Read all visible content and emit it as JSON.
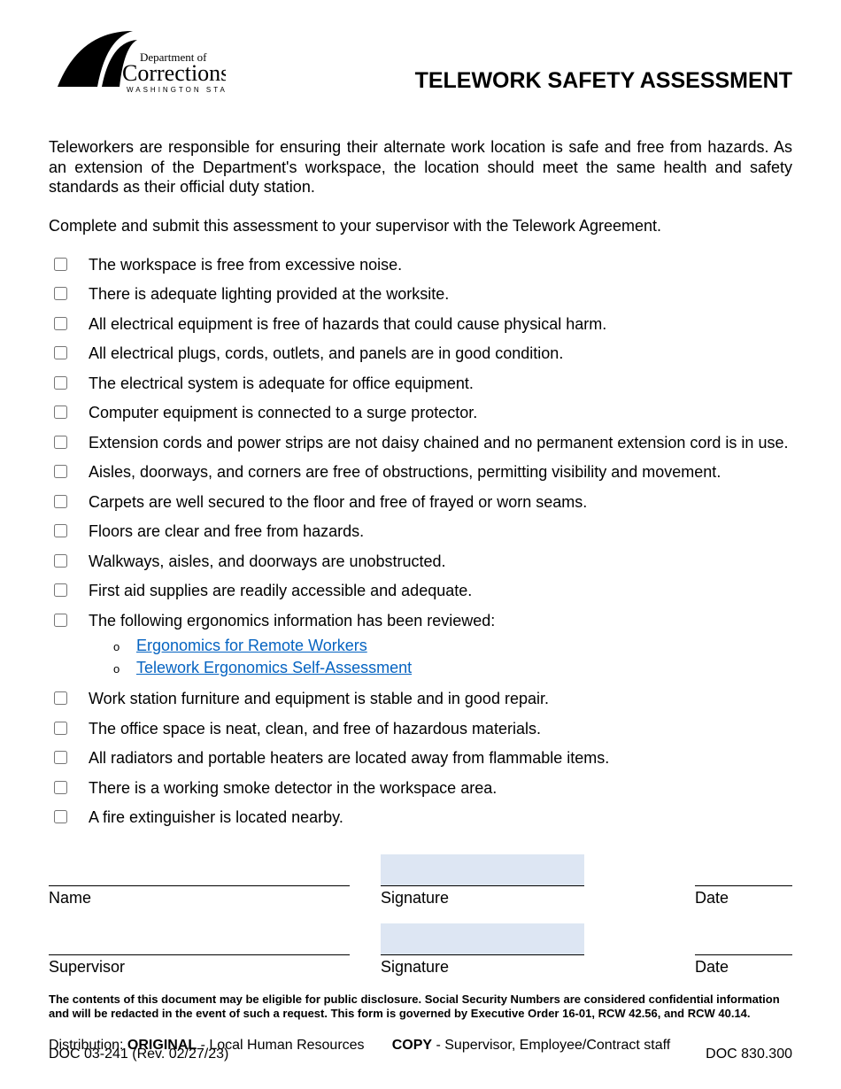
{
  "header": {
    "logo_alt": "Department of Corrections — Washington State",
    "title": "TELEWORK SAFETY ASSESSMENT"
  },
  "intro": "Teleworkers are responsible for ensuring their alternate work location is safe and free from hazards.  As an extension of the Department's workspace, the location should meet the same health and safety standards as their official duty station.",
  "instruction": "Complete and submit this assessment to your supervisor with the Telework Agreement.",
  "checklist": [
    "The workspace is free from excessive noise.",
    "There is adequate lighting provided at the worksite.",
    "All electrical equipment is free of hazards that could cause physical harm.",
    "All electrical plugs, cords, outlets, and panels are in good condition.",
    "The electrical system is adequate for office equipment.",
    "Computer equipment is connected to a surge protector.",
    "Extension cords and power strips are not daisy chained and no permanent extension cord is in use.",
    "Aisles, doorways, and corners are free of obstructions, permitting visibility and movement.",
    "Carpets are well secured to the floor and free of frayed or worn seams.",
    "Floors are clear and free from hazards.",
    "Walkways, aisles, and doorways are unobstructed.",
    "First aid supplies are readily accessible and adequate.",
    "The following ergonomics information has been reviewed:",
    "Work station furniture and equipment is stable and in good repair.",
    "The office space is neat, clean, and free of hazardous materials.",
    "All radiators and portable heaters are located away from flammable items.",
    "There is a working smoke detector in the workspace area.",
    "A fire extinguisher is located nearby."
  ],
  "ergo_links": [
    "Ergonomics for Remote Workers",
    "Telework Ergonomics Self-Assessment"
  ],
  "sig": {
    "name": "Name",
    "signature": "Signature",
    "date": "Date",
    "supervisor": "Supervisor"
  },
  "disclosure": "The contents of this document may be eligible for public disclosure.  Social Security Numbers are considered confidential information and will be redacted in the event of such a request.  This form is governed by Executive Order 16-01, RCW 42.56, and RCW 40.14.",
  "distribution": {
    "label": "Distribution:  ",
    "original_bold": "ORIGINAL",
    "original_rest": " - Local Human Resources",
    "copy_bold": "COPY",
    "copy_rest": " - Supervisor, Employee/Contract staff"
  },
  "footer": {
    "left": "DOC 03-241 (Rev. 02/27/23)",
    "right": "DOC 830.300"
  }
}
